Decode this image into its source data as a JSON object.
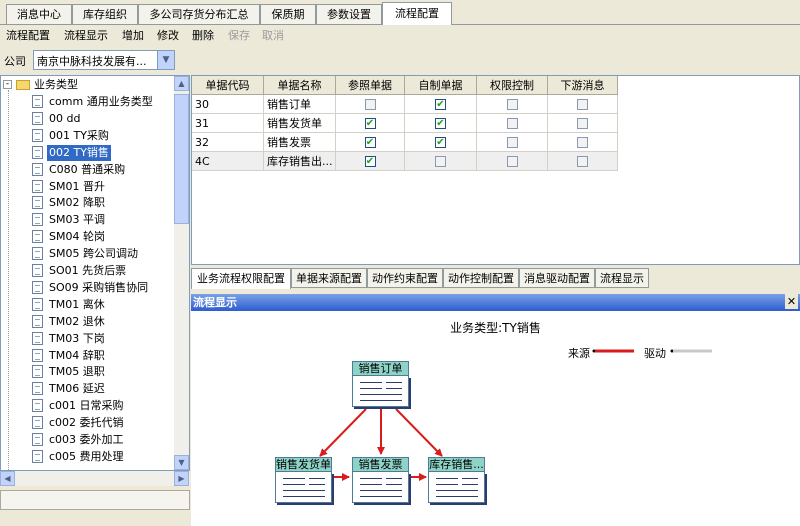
{
  "top_tabs": [
    {
      "label": "消息中心",
      "active": false
    },
    {
      "label": "库存组织",
      "active": false
    },
    {
      "label": "多公司存货分布汇总",
      "active": false
    },
    {
      "label": "保质期",
      "active": false
    },
    {
      "label": "参数设置",
      "active": false
    },
    {
      "label": "流程配置",
      "active": true
    }
  ],
  "toolbar": {
    "flow_config": "流程配置",
    "flow_display": "流程显示",
    "add": "增加",
    "edit": "修改",
    "delete": "删除",
    "save": "保存",
    "cancel": "取消"
  },
  "company": {
    "label": "公司",
    "value": "南京中脉科技发展有..."
  },
  "tree": {
    "root": "业务类型",
    "items": [
      "comm 通用业务类型",
      "00 dd",
      "001 TY采购",
      "002 TY销售",
      "C080 普通采购",
      "SM01 晋升",
      "SM02 降职",
      "SM03 平调",
      "SM04 轮岗",
      "SM05 跨公司调动",
      "SO01 先货后票",
      "SO09 采购销售协同",
      "TM01 离休",
      "TM02 退休",
      "TM03 下岗",
      "TM04 辞职",
      "TM05 退职",
      "TM06 延迟",
      "c001 日常采购",
      "c002 委托代销",
      "c003 委外加工",
      "c005 费用处理"
    ],
    "selected": "002 TY销售"
  },
  "grid": {
    "headers": [
      "单据代码",
      "单据名称",
      "参照单据",
      "自制单据",
      "权限控制",
      "下游消息"
    ],
    "rows": [
      {
        "code": "30",
        "name": "销售订单",
        "ref": false,
        "self": true,
        "perm": false,
        "down": false
      },
      {
        "code": "31",
        "name": "销售发货单",
        "ref": true,
        "self": true,
        "perm": false,
        "down": false
      },
      {
        "code": "32",
        "name": "销售发票",
        "ref": true,
        "self": true,
        "perm": false,
        "down": false
      },
      {
        "code": "4C",
        "name": "库存销售出...",
        "ref": true,
        "self": false,
        "perm": false,
        "down": false
      }
    ]
  },
  "bottom_tabs": [
    {
      "label": "业务流程权限配置",
      "active": true
    },
    {
      "label": "单据来源配置",
      "active": false
    },
    {
      "label": "动作约束配置",
      "active": false
    },
    {
      "label": "动作控制配置",
      "active": false
    },
    {
      "label": "消息驱动配置",
      "active": false
    },
    {
      "label": "流程显示",
      "active": false
    }
  ],
  "flow": {
    "panel_title": "流程显示",
    "close": "✕",
    "title": "业务类型:TY销售",
    "legend": {
      "source": "来源",
      "drive": "驱动"
    },
    "nodes": {
      "order": "销售订单",
      "delivery": "销售发货单",
      "invoice": "销售发票",
      "stockout": "库存销售..."
    },
    "colors": {
      "source": "#d91c1c",
      "drive": "#c8c8c8",
      "node_head": "#8fd3c6"
    }
  }
}
